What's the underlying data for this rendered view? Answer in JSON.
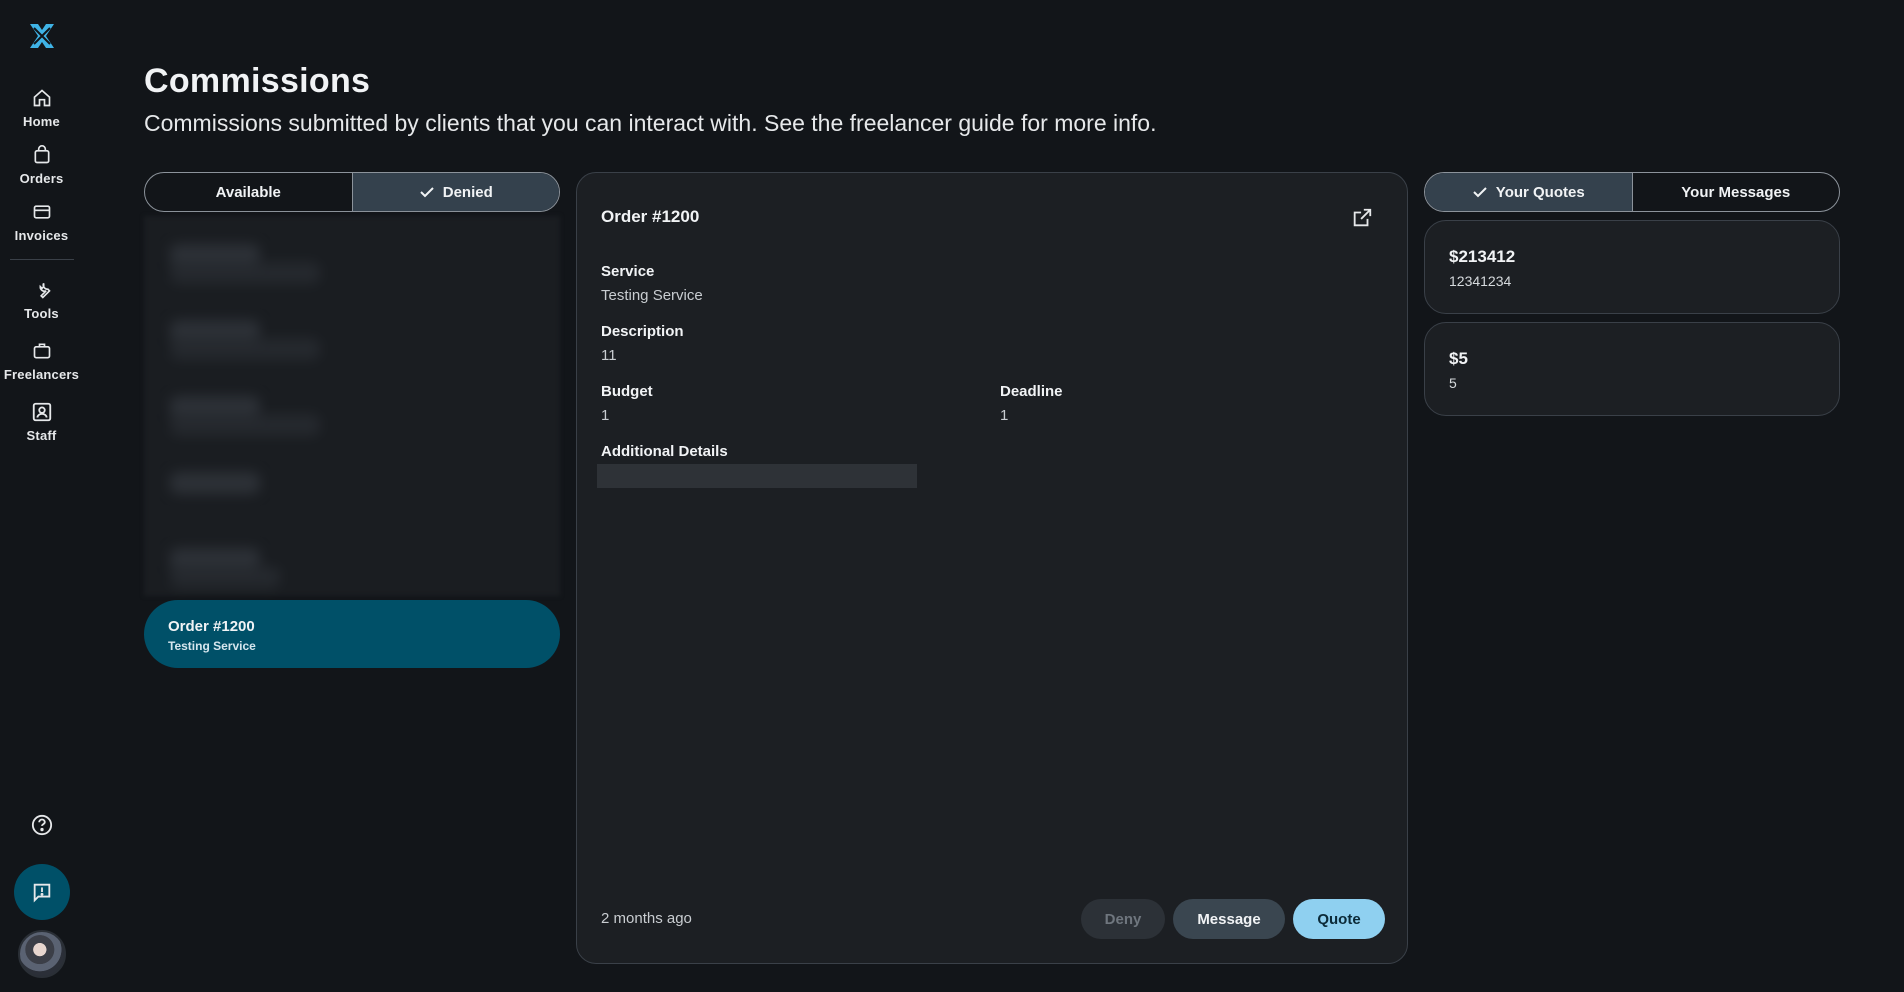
{
  "sidebar": {
    "items": [
      {
        "label": "Home",
        "icon": "home-icon"
      },
      {
        "label": "Orders",
        "icon": "shopping-bag-icon"
      },
      {
        "label": "Invoices",
        "icon": "credit-card-icon"
      },
      {
        "label": "Tools",
        "icon": "wrench-icon"
      },
      {
        "label": "Freelancers",
        "icon": "briefcase-icon"
      },
      {
        "label": "Staff",
        "icon": "id-badge-icon"
      }
    ]
  },
  "header": {
    "title": "Commissions",
    "subtitle": "Commissions submitted by clients that you can interact with. See the freelancer guide for more info."
  },
  "list_tabs": {
    "available": "Available",
    "denied": "Denied",
    "active": "denied"
  },
  "commission_list": {
    "selected": {
      "title": "Order #1200",
      "subtitle": "Testing Service"
    }
  },
  "detail": {
    "title": "Order #1200",
    "service_label": "Service",
    "service_value": "Testing Service",
    "description_label": "Description",
    "description_value": "11",
    "budget_label": "Budget",
    "budget_value": "1",
    "deadline_label": "Deadline",
    "deadline_value": "1",
    "additional_label": "Additional Details",
    "timestamp": "2 months ago",
    "buttons": {
      "deny": "Deny",
      "message": "Message",
      "quote": "Quote"
    }
  },
  "right_tabs": {
    "quotes": "Your Quotes",
    "messages": "Your Messages",
    "active": "quotes"
  },
  "quotes": [
    {
      "amount": "$213412",
      "sub": "12341234"
    },
    {
      "amount": "$5",
      "sub": "5"
    }
  ],
  "colors": {
    "background": "#121519",
    "accent": "#005068",
    "quote_button": "#8fd0f0",
    "logo": "#3fb3e6"
  }
}
